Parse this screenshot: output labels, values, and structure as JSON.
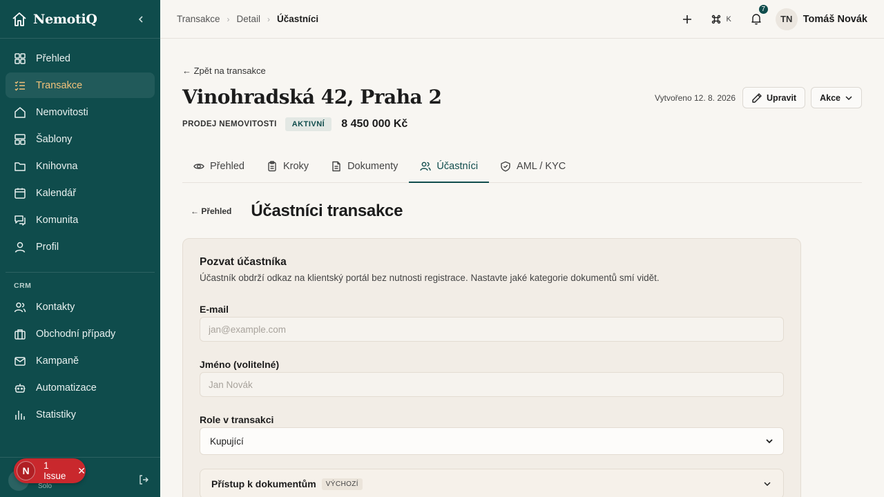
{
  "app": {
    "name": "NemotiQ"
  },
  "sidebar": {
    "items": [
      {
        "label": "Přehled",
        "icon": "dashboard-icon"
      },
      {
        "label": "Transakce",
        "icon": "checklist-icon",
        "active": true
      },
      {
        "label": "Nemovitosti",
        "icon": "home-icon"
      },
      {
        "label": "Šablony",
        "icon": "template-icon"
      },
      {
        "label": "Knihovna",
        "icon": "folder-icon"
      },
      {
        "label": "Kalendář",
        "icon": "calendar-icon"
      },
      {
        "label": "Komunita",
        "icon": "chat-icon"
      },
      {
        "label": "Profil",
        "icon": "user-icon"
      }
    ],
    "crm_section": "CRM",
    "crm_items": [
      {
        "label": "Kontakty",
        "icon": "contacts-icon"
      },
      {
        "label": "Obchodní případy",
        "icon": "briefcase-icon"
      },
      {
        "label": "Kampaně",
        "icon": "mail-icon"
      },
      {
        "label": "Automatizace",
        "icon": "bot-icon"
      },
      {
        "label": "Statistiky",
        "icon": "chart-icon"
      }
    ],
    "footer_sub": "Solo"
  },
  "issue": {
    "letter": "N",
    "label": "1 Issue"
  },
  "topbar": {
    "breadcrumbs": [
      "Transakce",
      "Detail",
      "Účastníci"
    ],
    "shortcut_key": "K",
    "notifications": "7",
    "user_initials": "TN",
    "user_name": "Tomáš Novák"
  },
  "transaction": {
    "back_label": "← Zpět na transakce",
    "title": "Vinohradská 42, Praha 2",
    "type": "PRODEJ NEMOVITOSTI",
    "status": "AKTIVNÍ",
    "price": "8 450 000 Kč",
    "created": "Vytvořeno 12. 8. 2026",
    "edit_label": "Upravit",
    "actions_label": "Akce"
  },
  "tabs": [
    {
      "label": "Přehled",
      "icon": "eye-icon"
    },
    {
      "label": "Kroky",
      "icon": "clipboard-icon"
    },
    {
      "label": "Dokumenty",
      "icon": "document-icon"
    },
    {
      "label": "Účastníci",
      "icon": "users-icon",
      "active": true
    },
    {
      "label": "AML / KYC",
      "icon": "shield-icon"
    }
  ],
  "participants": {
    "back_label": "← Přehled",
    "title": "Účastníci transakce"
  },
  "invite": {
    "title": "Pozvat účastníka",
    "description": "Účastník obdrží odkaz na klientský portál bez nutnosti registrace. Nastavte jaké kategorie dokumentů smí vidět.",
    "email_label": "E-mail",
    "email_placeholder": "jan@example.com",
    "name_label": "Jméno (volitelné)",
    "name_placeholder": "Jan Novák",
    "role_label": "Role v transakci",
    "role_value": "Kupující",
    "access_title": "Přístup k dokumentům",
    "access_badge": "VÝCHOZÍ"
  },
  "colors": {
    "sidebar": "#0f4c4c",
    "accent": "#f2c27a",
    "issue": "#c9282d"
  }
}
